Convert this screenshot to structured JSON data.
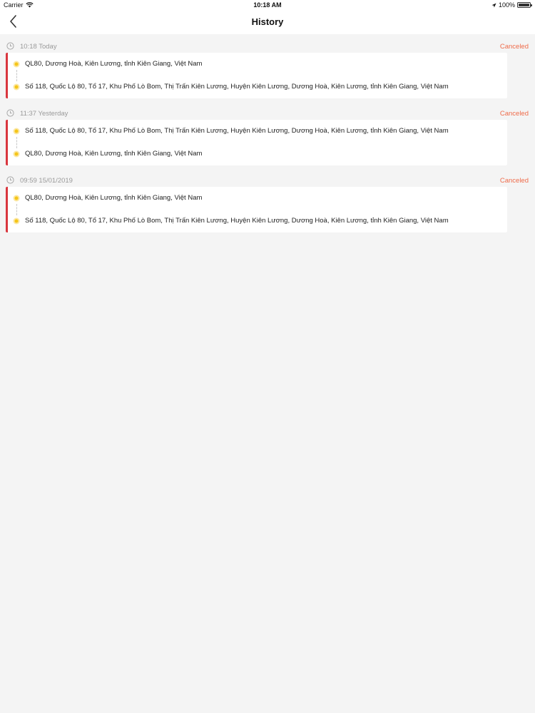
{
  "status_bar": {
    "carrier": "Carrier",
    "time": "10:18 AM",
    "battery": "100%"
  },
  "nav": {
    "title": "History",
    "back_icon": "chevron-left-icon"
  },
  "colors": {
    "accent_red": "#d9363e",
    "status_orange": "#ef6b4a",
    "dot_yellow": "#f5c518",
    "background": "#f4f4f4"
  },
  "trips": [
    {
      "datetime": "10:18 Today",
      "status": "Canceled",
      "pickup": "QL80, Dương Hoà, Kiên Lương, tỉnh Kiên Giang, Việt Nam",
      "dropoff": "Số 118, Quốc Lộ 80, Tổ 17, Khu Phố Lò Bom, Thị Trấn Kiên Lương, Huyện Kiên Lương, Dương Hoà, Kiên Lương, tỉnh Kiên Giang, Việt Nam"
    },
    {
      "datetime": "11:37 Yesterday",
      "status": "Canceled",
      "pickup": "Số 118, Quốc Lộ 80, Tổ 17, Khu Phố Lò Bom, Thị Trấn Kiên Lương, Huyện Kiên Lương, Dương Hoà, Kiên Lương, tỉnh Kiên Giang, Việt Nam",
      "dropoff": "QL80, Dương Hoà, Kiên Lương, tỉnh Kiên Giang, Việt Nam"
    },
    {
      "datetime": "09:59 15/01/2019",
      "status": "Canceled",
      "pickup": "QL80, Dương Hoà, Kiên Lương, tỉnh Kiên Giang, Việt Nam",
      "dropoff": "Số 118, Quốc Lộ 80, Tổ 17, Khu Phố Lò Bom, Thị Trấn Kiên Lương, Huyện Kiên Lương, Dương Hoà, Kiên Lương, tỉnh Kiên Giang, Việt Nam"
    }
  ]
}
